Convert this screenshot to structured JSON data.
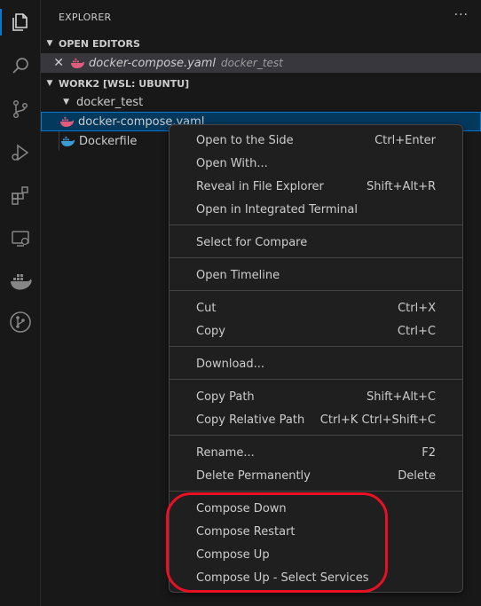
{
  "sidebar": {
    "title": "EXPLORER",
    "more_label": "···",
    "open_editors": {
      "header": "OPEN EDITORS",
      "items": [
        {
          "name": "docker-compose.yaml",
          "folder": "docker_test"
        }
      ]
    },
    "workspace": {
      "header": "WORK2 [WSL: UBUNTU]",
      "folder": "docker_test",
      "files": [
        {
          "name": "docker-compose.yaml"
        },
        {
          "name": "Dockerfile"
        }
      ]
    }
  },
  "context_menu": {
    "items": [
      {
        "label": "Open to the Side",
        "shortcut": "Ctrl+Enter"
      },
      {
        "label": "Open With...",
        "shortcut": ""
      },
      {
        "label": "Reveal in File Explorer",
        "shortcut": "Shift+Alt+R"
      },
      {
        "label": "Open in Integrated Terminal",
        "shortcut": ""
      },
      {
        "label": "Select for Compare",
        "shortcut": ""
      },
      {
        "label": "Open Timeline",
        "shortcut": ""
      },
      {
        "label": "Cut",
        "shortcut": "Ctrl+X"
      },
      {
        "label": "Copy",
        "shortcut": "Ctrl+C"
      },
      {
        "label": "Download...",
        "shortcut": ""
      },
      {
        "label": "Copy Path",
        "shortcut": "Shift+Alt+C"
      },
      {
        "label": "Copy Relative Path",
        "shortcut": "Ctrl+K Ctrl+Shift+C"
      },
      {
        "label": "Rename...",
        "shortcut": "F2"
      },
      {
        "label": "Delete Permanently",
        "shortcut": "Delete"
      },
      {
        "label": "Compose Down",
        "shortcut": ""
      },
      {
        "label": "Compose Restart",
        "shortcut": ""
      },
      {
        "label": "Compose Up",
        "shortcut": ""
      },
      {
        "label": "Compose Up - Select Services",
        "shortcut": ""
      }
    ]
  },
  "colors": {
    "accent": "#0078d4",
    "highlight": "#e81123",
    "docker_compose_icon": "#e05c7e",
    "dockerfile_icon": "#3a9bd5"
  },
  "activity_icons": [
    "files-icon",
    "search-icon",
    "source-control-icon",
    "run-debug-icon",
    "extensions-icon",
    "remote-explorer-icon",
    "docker-icon",
    "git-graph-icon"
  ]
}
